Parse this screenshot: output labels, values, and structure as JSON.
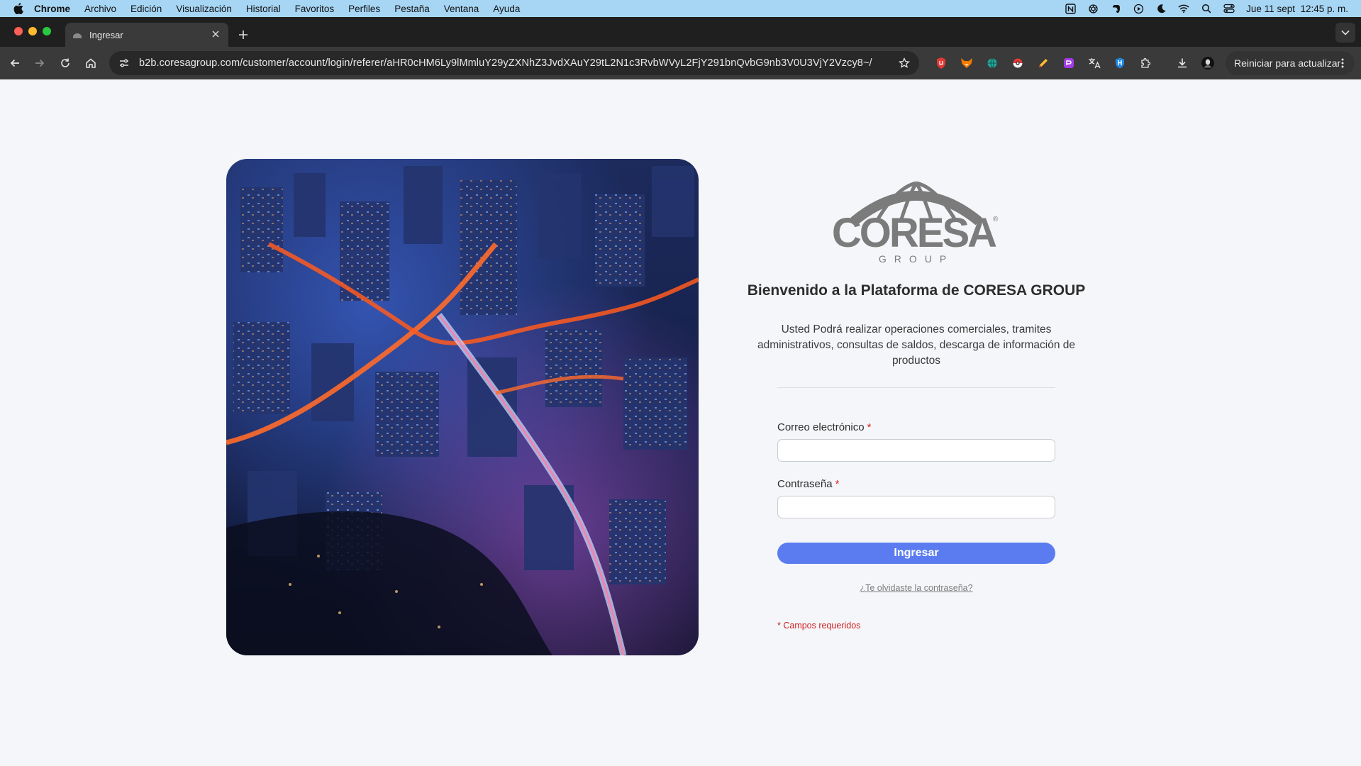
{
  "menubar": {
    "app": "Chrome",
    "items": [
      "Archivo",
      "Edición",
      "Visualización",
      "Historial",
      "Favoritos",
      "Perfiles",
      "Pestaña",
      "Ventana",
      "Ayuda"
    ],
    "status_icons": [
      "notion-icon",
      "openai-icon",
      "evernote-icon",
      "play-icon",
      "moon-icon",
      "wifi-icon",
      "spotlight-search-icon",
      "control-center-icon"
    ],
    "clock": "Jue 11 sept  12:45 p. m."
  },
  "browser": {
    "tab_title": "Ingresar",
    "url": "b2b.coresagroup.com/customer/account/login/referer/aHR0cHM6Ly9lMmluY29yZXNhZ3JvdXAuY29tL2N1c3RvbWVyL2FjY291bnQvbG9nb3V0U3VjY2Vzcy8~/",
    "relaunch_label": "Reiniciar para actualizar"
  },
  "login": {
    "logo_text": "CORESA",
    "logo_subtext": "GROUP",
    "logo_registered": "®",
    "welcome": "Bienvenido a la Plataforma de CORESA GROUP",
    "description": "Usted Podrá realizar operaciones comerciales, tramites administrativos, consultas de saldos, descarga de información de productos",
    "email_label": "Correo electrónico",
    "password_label": "Contraseña",
    "required_mark": "*",
    "email_value": "",
    "password_value": "",
    "submit_label": "Ingresar",
    "forgot_label": "¿Te olvidaste la contraseña?",
    "required_note": "* Campos requeridos"
  },
  "colors": {
    "accent": "#5b7cf0",
    "required": "#e02424",
    "menubar": "#a7d6f5",
    "logo_gray": "#7b7b7b"
  }
}
